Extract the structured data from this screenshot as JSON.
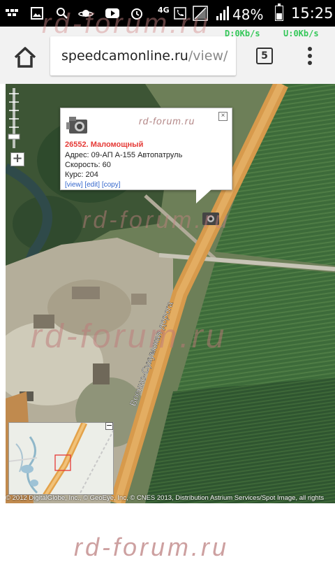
{
  "status_bar": {
    "network_type": "4G",
    "battery_percent": "48%",
    "battery_level": 0.48,
    "time": "15:25",
    "download_speed": "D:0Kb/s",
    "upload_speed": "U:0Kb/s",
    "icons": [
      "bbm-icon",
      "image-icon",
      "search-icon",
      "saturn-icon",
      "youtube-icon",
      "alarm-icon",
      "phone-icon",
      "no-sim-icon",
      "signal-icon",
      "battery-icon"
    ]
  },
  "browser": {
    "url_domain": "speedcamonline.ru",
    "url_path": "/view/",
    "tab_count": "5"
  },
  "map": {
    "road_label": "Военно-Сухумская дорога",
    "popup": {
      "title": "26552. Маломощный",
      "address": "Адрес: 09-АП А-155 Автопатруль",
      "speed": "Скорость: 60",
      "course": "Курс: 204",
      "link_view": "[view]",
      "link_edit": "[edit]",
      "link_copy": "[copy]",
      "close_symbol": "×"
    },
    "zoom_in_symbol": "+",
    "minimap_minimize_symbol": "−",
    "copyright": "© 2012 DigitalGlobe, Inc., © GeoEye, Inc, © CNES 2013, Distribution Astrium Services/Spot Image, all rights"
  },
  "watermarks": {
    "top": "rd-forum.ru",
    "popup": "rd-forum.ru",
    "map1": "rd-forum.ru",
    "map2": "rd-forum.ru",
    "bottom": "rd-forum.ru"
  }
}
